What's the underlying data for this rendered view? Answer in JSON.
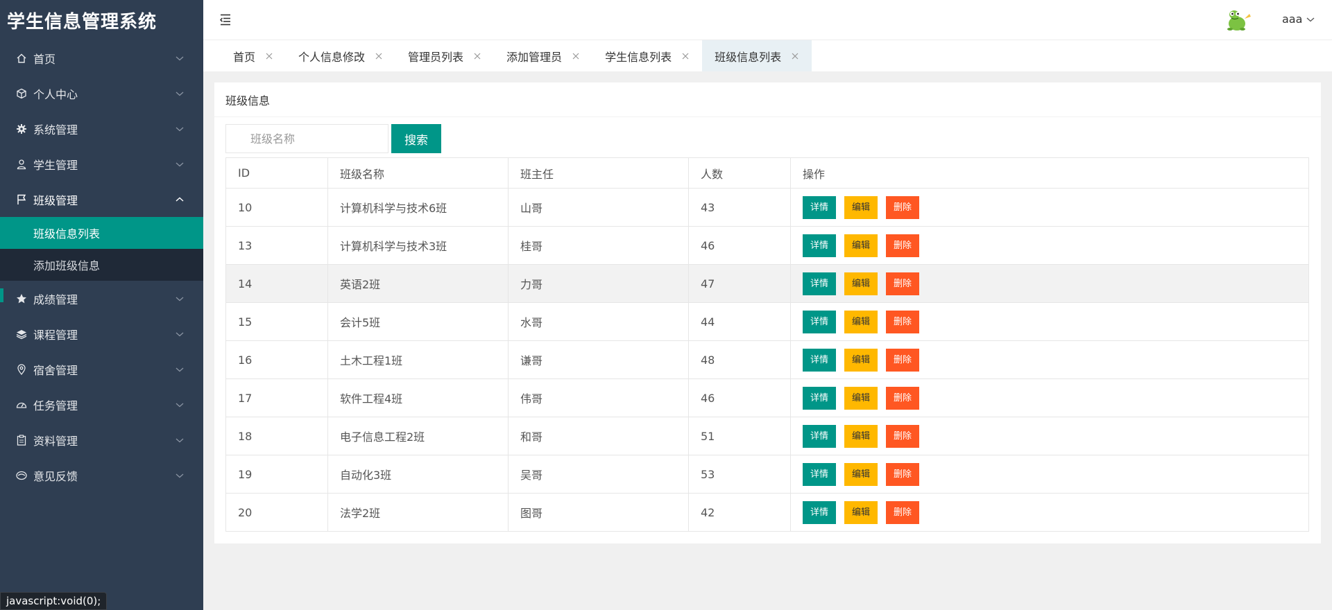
{
  "app": {
    "title": "学生信息管理系统"
  },
  "sidebar": {
    "items": [
      {
        "label": "首页",
        "icon": "home-icon"
      },
      {
        "label": "个人中心",
        "icon": "cube-icon"
      },
      {
        "label": "系统管理",
        "icon": "gear-icon"
      },
      {
        "label": "学生管理",
        "icon": "user-icon"
      },
      {
        "label": "班级管理",
        "icon": "flag-icon",
        "open": true,
        "children": [
          {
            "label": "班级信息列表",
            "active": true
          },
          {
            "label": "添加班级信息"
          }
        ]
      },
      {
        "label": "成绩管理",
        "icon": "star-icon"
      },
      {
        "label": "课程管理",
        "icon": "layers-icon"
      },
      {
        "label": "宿舍管理",
        "icon": "location-icon"
      },
      {
        "label": "任务管理",
        "icon": "dashboard-icon"
      },
      {
        "label": "资料管理",
        "icon": "clipboard-icon"
      },
      {
        "label": "意见反馈",
        "icon": "feedback-icon"
      }
    ]
  },
  "header": {
    "username": "aaa"
  },
  "tabs": [
    {
      "label": "首页"
    },
    {
      "label": "个人信息修改"
    },
    {
      "label": "管理员列表"
    },
    {
      "label": "添加管理员"
    },
    {
      "label": "学生信息列表"
    },
    {
      "label": "班级信息列表",
      "active": true
    }
  ],
  "main": {
    "card_title": "班级信息",
    "search": {
      "placeholder": "班级名称",
      "button_label": "搜索"
    },
    "table": {
      "headers": [
        "ID",
        "班级名称",
        "班主任",
        "人数",
        "操作"
      ],
      "rows": [
        [
          "10",
          "计算机科学与技术6班",
          "山哥",
          "43"
        ],
        [
          "13",
          "计算机科学与技术3班",
          "桂哥",
          "46"
        ],
        [
          "14",
          "英语2班",
          "力哥",
          "47"
        ],
        [
          "15",
          "会计5班",
          "水哥",
          "44"
        ],
        [
          "16",
          "土木工程1班",
          "谦哥",
          "48"
        ],
        [
          "17",
          "软件工程4班",
          "伟哥",
          "46"
        ],
        [
          "18",
          "电子信息工程2班",
          "和哥",
          "51"
        ],
        [
          "19",
          "自动化3班",
          "吴哥",
          "53"
        ],
        [
          "20",
          "法学2班",
          "图哥",
          "42"
        ]
      ],
      "actions": {
        "detail": "详情",
        "edit": "编辑",
        "delete": "删除"
      }
    }
  },
  "statusbar": {
    "text": "javascript:void(0);"
  },
  "colors": {
    "sidebar_bg": "#2f3e52",
    "accent": "#009688",
    "warn": "#ffb800",
    "danger": "#ff5722"
  }
}
